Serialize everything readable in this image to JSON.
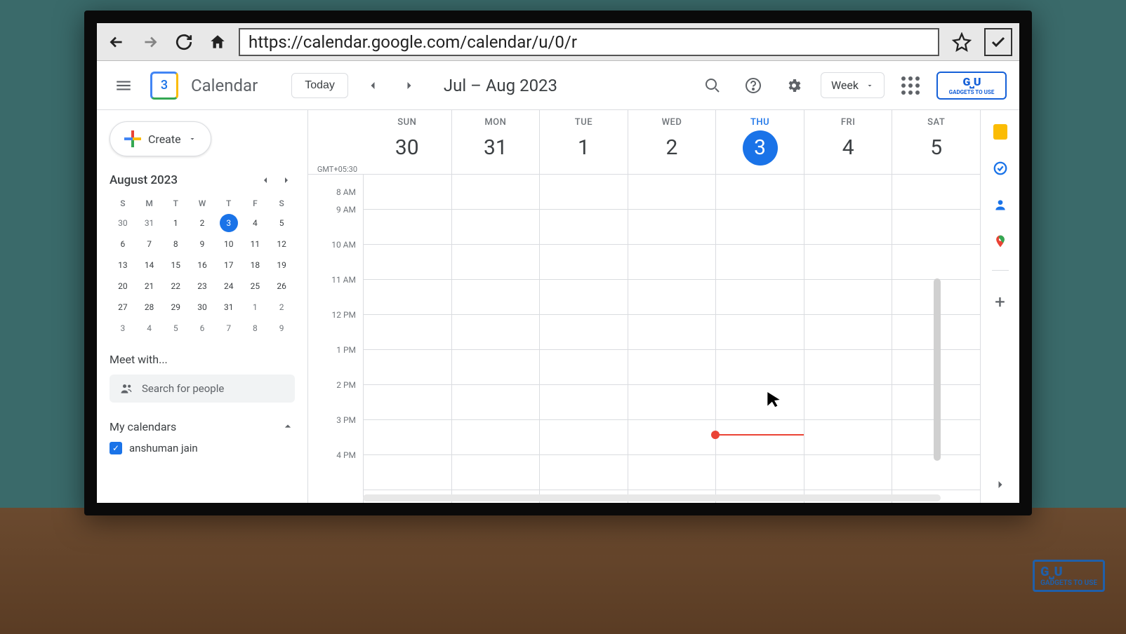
{
  "browser": {
    "url": "https://calendar.google.com/calendar/u/0/r"
  },
  "header": {
    "logo_day": "3",
    "app_name": "Calendar",
    "today_label": "Today",
    "date_range": "Jul – Aug 2023",
    "view_label": "Week"
  },
  "sidebar": {
    "create_label": "Create",
    "mini_cal": {
      "title": "August 2023",
      "dow": [
        "S",
        "M",
        "T",
        "W",
        "T",
        "F",
        "S"
      ],
      "weeks": [
        [
          "30",
          "31",
          "1",
          "2",
          "3",
          "4",
          "5"
        ],
        [
          "6",
          "7",
          "8",
          "9",
          "10",
          "11",
          "12"
        ],
        [
          "13",
          "14",
          "15",
          "16",
          "17",
          "18",
          "19"
        ],
        [
          "20",
          "21",
          "22",
          "23",
          "24",
          "25",
          "26"
        ],
        [
          "27",
          "28",
          "29",
          "30",
          "31",
          "1",
          "2"
        ],
        [
          "3",
          "4",
          "5",
          "6",
          "7",
          "8",
          "9"
        ]
      ],
      "muted_start": 2,
      "muted_end_row": 4,
      "muted_end_col": 5,
      "today": "3"
    },
    "meet_title": "Meet with...",
    "people_placeholder": "Search for people",
    "my_calendars_label": "My calendars",
    "calendar_item": "anshuman jain"
  },
  "grid": {
    "timezone": "GMT+05:30",
    "days": [
      {
        "dow": "SUN",
        "num": "30",
        "today": false
      },
      {
        "dow": "MON",
        "num": "31",
        "today": false
      },
      {
        "dow": "TUE",
        "num": "1",
        "today": false
      },
      {
        "dow": "WED",
        "num": "2",
        "today": false
      },
      {
        "dow": "THU",
        "num": "3",
        "today": true
      },
      {
        "dow": "FRI",
        "num": "4",
        "today": false
      },
      {
        "dow": "SAT",
        "num": "5",
        "today": false
      }
    ],
    "hours": [
      "8 AM",
      "9 AM",
      "10 AM",
      "11 AM",
      "12 PM",
      "1 PM",
      "2 PM",
      "3 PM",
      "4 PM"
    ]
  },
  "brand": "GADGETS TO USE"
}
